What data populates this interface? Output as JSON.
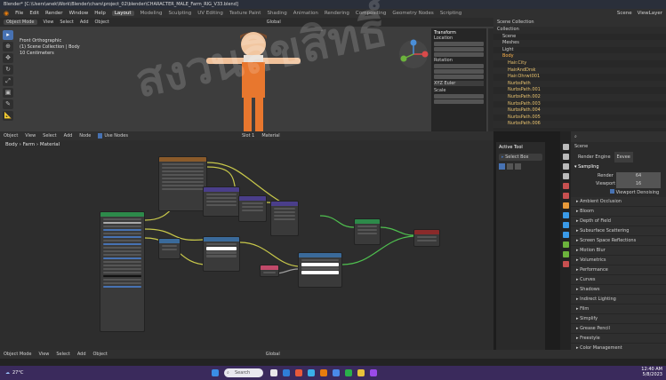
{
  "window": {
    "title": "Blender* [C:\\Users\\anek\\Work\\Blender\\chars\\project_02\\blender\\CHARACTER_MALE_Farm_RIG_V33.blend]"
  },
  "menu": {
    "items": [
      "File",
      "Edit",
      "Render",
      "Window",
      "Help"
    ],
    "tabs": [
      "Layout",
      "Modeling",
      "Sculpting",
      "UV Editing",
      "Texture Paint",
      "Shading",
      "Animation",
      "Rendering",
      "Compositing",
      "Geometry Nodes",
      "Scripting"
    ],
    "active_tab": "Layout",
    "scene": "Scene",
    "view_layer": "ViewLayer"
  },
  "viewport": {
    "header": [
      "Object Mode",
      "View",
      "Select",
      "Add",
      "Object"
    ],
    "transform": "Global",
    "info": [
      "Front Orthographic",
      "(1) Scene Collection | Body",
      "10 Centimeters"
    ]
  },
  "npanel": {
    "title": "Transform",
    "labels": [
      "Location",
      "X",
      "Y",
      "Z",
      "Rotation",
      "X",
      "Y",
      "Z",
      "XYZ Euler",
      "Scale",
      "X",
      "Y"
    ],
    "values": [
      "0 m",
      "0 m",
      "0 m",
      "0°",
      "0°",
      "-180°",
      "1.256",
      "1.256"
    ]
  },
  "outliner": {
    "header": "Scene Collection",
    "rows": [
      "Collection",
      "Scene",
      "Meshes",
      "Light",
      "Body",
      "Hair.City",
      "HairAndDrsk",
      "Hair.Ohrwt001",
      "NurbsPath",
      "NurbsPath.001",
      "NurbsPath.002",
      "NurbsPath.003",
      "NurbsPath.004",
      "NurbsPath.005",
      "NurbsPath.006"
    ]
  },
  "node_editor": {
    "header": [
      "Object",
      "View",
      "Select",
      "Add",
      "Node",
      "Use Nodes"
    ],
    "slot": "Slot 1",
    "material": "Material",
    "breadcrumb": [
      "Body",
      "Farm",
      "Material"
    ]
  },
  "active_tool": {
    "title": "Active Tool",
    "tool": "Select Box"
  },
  "properties": {
    "scene": "Scene",
    "render_engine_label": "Render Engine",
    "render_engine": "Eevee",
    "sampling": "Sampling",
    "render_label": "Render",
    "render_value": "64",
    "viewport_label": "Viewport",
    "viewport_value": "16",
    "viewport_denoising": "Viewport Denoising",
    "sections": [
      "Ambient Occlusion",
      "Bloom",
      "Depth of Field",
      "Subsurface Scattering",
      "Screen Space Reflections",
      "Motion Blur",
      "Volumetrics",
      "Performance",
      "Curves",
      "Shadows",
      "Indirect Lighting",
      "Film",
      "Simplify",
      "Grease Pencil",
      "Freestyle",
      "Color Management"
    ]
  },
  "bottom": {
    "header": [
      "Object Mode",
      "View",
      "Select",
      "Add",
      "Object"
    ],
    "transform": "Global"
  },
  "taskbar": {
    "weather_temp": "27°C",
    "search": "Search",
    "time": "12:40 AM",
    "date": "5/8/2023"
  },
  "watermark": "สงวนลิขสิทธิ์"
}
